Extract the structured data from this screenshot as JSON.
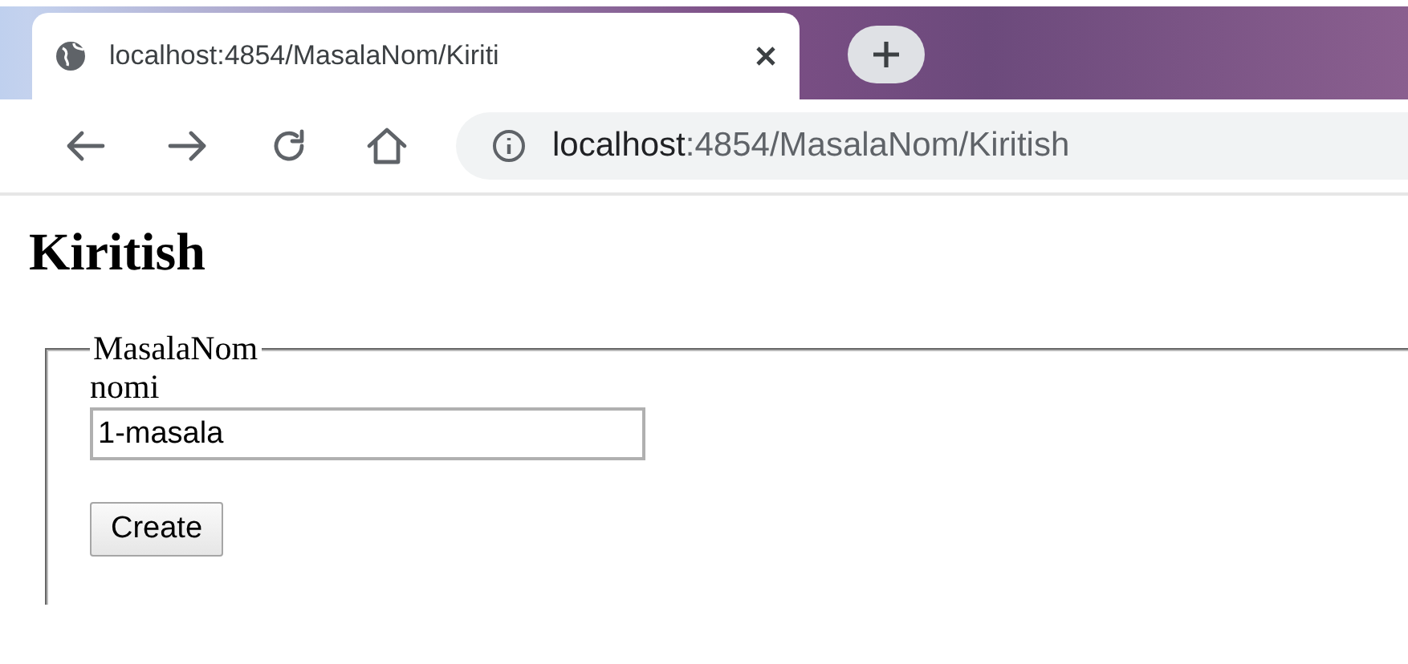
{
  "tabs": [
    {
      "title": "localhost:4854/MasalaNom/Kiriti",
      "selected": true
    }
  ],
  "toolbar": {
    "address_host": "localhost",
    "address_path": ":4854/MasalaNom/Kiritish"
  },
  "page": {
    "heading": "Kiritish",
    "fieldset": {
      "legend": "MasalaNom",
      "field_label": "nomi",
      "field_value": "1-masala",
      "button": "Create"
    }
  }
}
